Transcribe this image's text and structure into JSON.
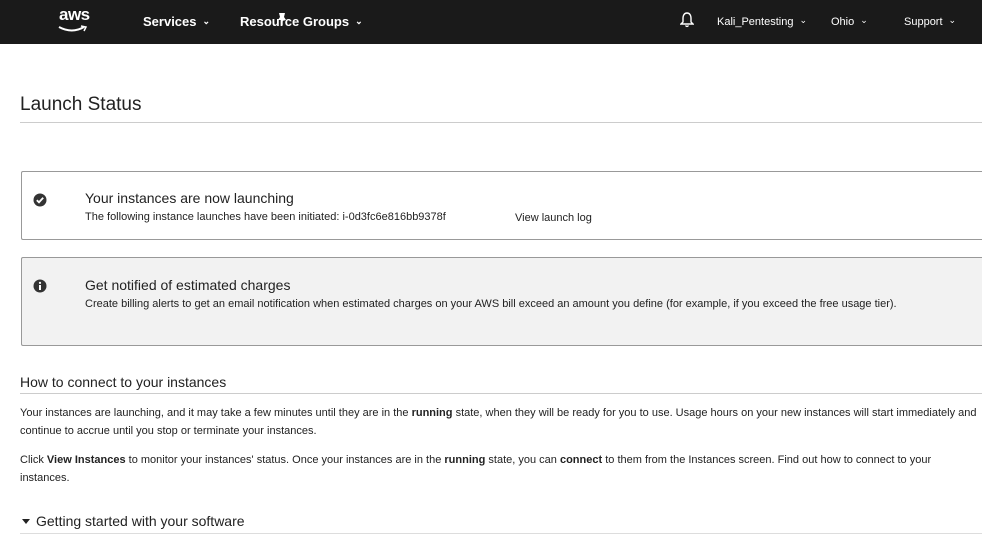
{
  "topbar": {
    "logo": "aws",
    "services": "Services",
    "resource_groups": "Resource Groups",
    "pin_icon": "pin-icon",
    "bell_icon": "bell-icon",
    "account": "Kali_Pentesting",
    "region": "Ohio",
    "support": "Support"
  },
  "page": {
    "title": "Launch Status"
  },
  "launch_box": {
    "icon": "check-circle-icon",
    "title": "Your instances are now launching",
    "text": "The following instance launches have been initiated:",
    "instance_id": "i-0d3fc6e816bb9378f",
    "view_log": "View launch log"
  },
  "billing_box": {
    "icon": "info-circle-icon",
    "title": "Get notified of estimated charges",
    "text_link": "Create billing alerts",
    "text_rest": "to get an email notification when estimated charges on your AWS bill exceed an amount you define (for example, if you exceed the free usage tier)."
  },
  "connect": {
    "heading": "How to connect to your instances",
    "p1_a": "Your instances are launching, and it may take a few minutes until they are in the",
    "p1_bold": "running",
    "p1_b": "state, when they will be ready for you to use. Usage hours on your new instances will start immediately and continue to accrue until you stop or terminate your instances.",
    "p2_a": "Click",
    "p2_link": "View Instances",
    "p2_b": "to monitor your instances' status. Once your instances are in the",
    "p2_bold1": "running",
    "p2_c": "state, you can",
    "p2_bold2": "connect",
    "p2_d": "to them from the Instances screen.",
    "p2_link2": "Find out",
    "p2_e": "how to connect to your instances."
  },
  "getting_started": {
    "label": "Getting started with your software",
    "icon": "triangle-down-icon"
  }
}
